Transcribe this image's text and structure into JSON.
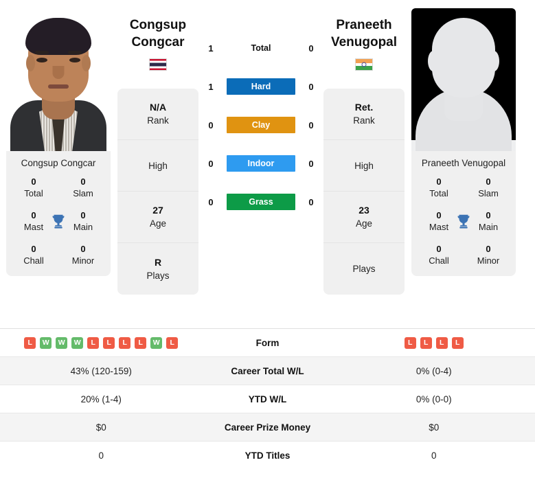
{
  "players": {
    "left": {
      "first_name": "Congsup",
      "last_name": "Congcar",
      "full_name": "Congsup Congcar",
      "country_flag": "thailand-flag",
      "avatar_type": "photo",
      "titles": [
        {
          "value": "0",
          "label": "Total"
        },
        {
          "value": "0",
          "label": "Slam"
        },
        {
          "value": "0",
          "label": "Mast"
        },
        {
          "value": "0",
          "label": "Main"
        },
        {
          "value": "0",
          "label": "Chall"
        },
        {
          "value": "0",
          "label": "Minor"
        }
      ],
      "info": [
        {
          "value": "N/A",
          "label": "Rank"
        },
        {
          "value": "",
          "label": "High"
        },
        {
          "value": "27",
          "label": "Age"
        },
        {
          "value": "R",
          "label": "Plays"
        }
      ],
      "form": [
        "L",
        "W",
        "W",
        "W",
        "L",
        "L",
        "L",
        "L",
        "W",
        "L"
      ],
      "career_total_wl": "43% (120-159)",
      "ytd_wl": "20% (1-4)",
      "career_prize_money": "$0",
      "ytd_titles": "0"
    },
    "right": {
      "first_name": "Praneeth",
      "last_name": "Venugopal",
      "full_name": "Praneeth Venugopal",
      "country_flag": "india-flag",
      "avatar_type": "silhouette-placeholder",
      "titles": [
        {
          "value": "0",
          "label": "Total"
        },
        {
          "value": "0",
          "label": "Slam"
        },
        {
          "value": "0",
          "label": "Mast"
        },
        {
          "value": "0",
          "label": "Main"
        },
        {
          "value": "0",
          "label": "Chall"
        },
        {
          "value": "0",
          "label": "Minor"
        }
      ],
      "info": [
        {
          "value": "Ret.",
          "label": "Rank"
        },
        {
          "value": "",
          "label": "High"
        },
        {
          "value": "23",
          "label": "Age"
        },
        {
          "value": "",
          "label": "Plays"
        }
      ],
      "form": [
        "L",
        "L",
        "L",
        "L"
      ],
      "career_total_wl": "0% (0-4)",
      "ytd_wl": "0% (0-0)",
      "career_prize_money": "$0",
      "ytd_titles": "0"
    }
  },
  "head_to_head": {
    "rows": [
      {
        "left": "1",
        "label": "Total",
        "right": "0",
        "color": ""
      },
      {
        "left": "1",
        "label": "Hard",
        "right": "0",
        "color": "#0B6CB8"
      },
      {
        "left": "0",
        "label": "Clay",
        "right": "0",
        "color": "#E09311"
      },
      {
        "left": "0",
        "label": "Indoor",
        "right": "0",
        "color": "#2E9BF0"
      },
      {
        "left": "0",
        "label": "Grass",
        "right": "0",
        "color": "#0D9B47"
      }
    ]
  },
  "stats_table": {
    "rows": [
      {
        "label": "Form"
      },
      {
        "label": "Career Total W/L"
      },
      {
        "label": "YTD W/L"
      },
      {
        "label": "Career Prize Money"
      },
      {
        "label": "YTD Titles"
      }
    ]
  },
  "colors": {
    "hard": "#0B6CB8",
    "clay": "#E09311",
    "indoor": "#2E9BF0",
    "grass": "#0D9B47",
    "win": "#64BB6A",
    "loss": "#EF5B45",
    "trophy": "#3C73B4",
    "card_bg": "#F0F0F0",
    "row_alt_bg": "#F4F4F4"
  }
}
